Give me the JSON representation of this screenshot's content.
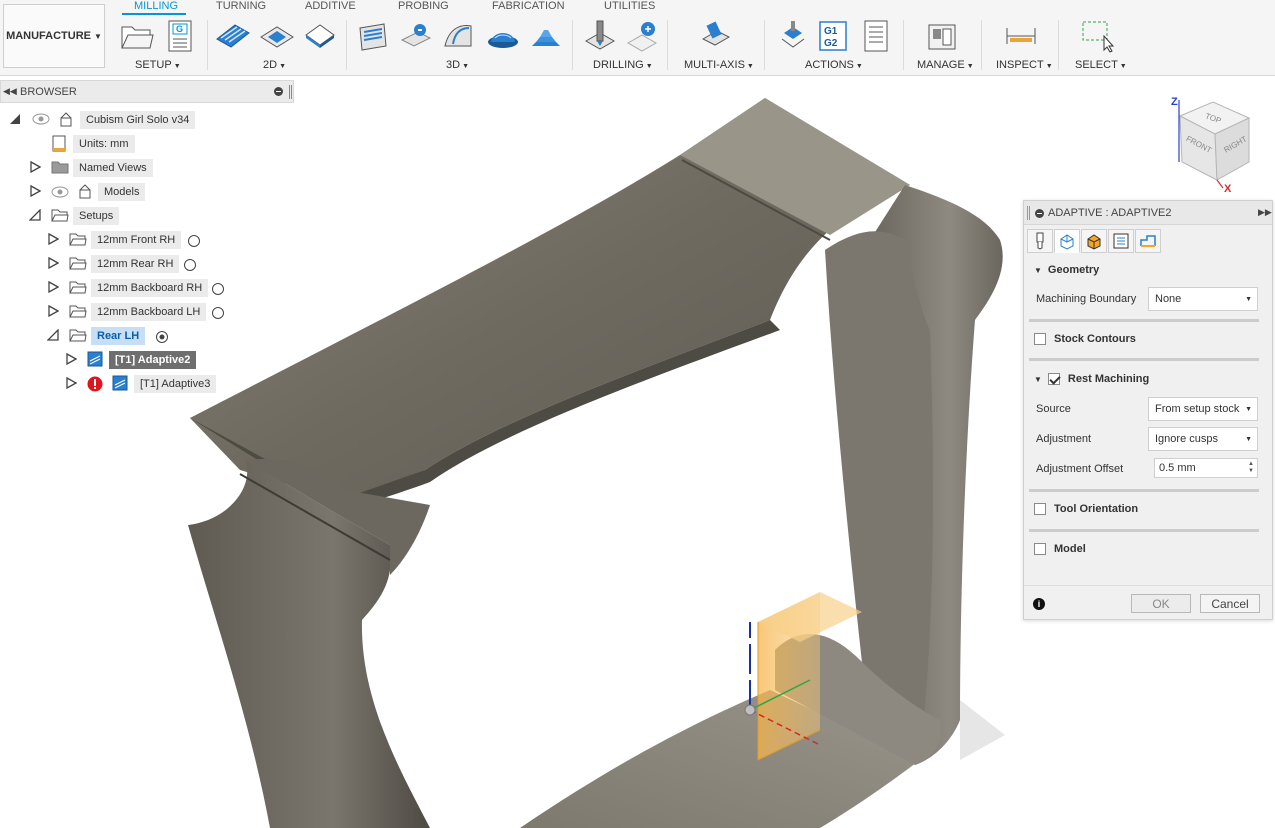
{
  "workspace": {
    "label": "MANUFACTURE"
  },
  "tabs": [
    {
      "label": "MILLING",
      "active": true
    },
    {
      "label": "TURNING"
    },
    {
      "label": "ADDITIVE"
    },
    {
      "label": "PROBING"
    },
    {
      "label": "FABRICATION"
    },
    {
      "label": "UTILITIES"
    }
  ],
  "groups": {
    "setup": "SETUP",
    "g2d": "2D",
    "g3d": "3D",
    "drilling": "DRILLING",
    "multiaxis": "MULTI-AXIS",
    "actions": "ACTIONS",
    "manage": "MANAGE",
    "inspect": "INSPECT",
    "select": "SELECT"
  },
  "icons": {
    "nc_program": "G",
    "post_process": "G1\nG2"
  },
  "browser": {
    "title": "BROWSER",
    "root": "Cubism Girl Solo v34",
    "units": "Units: mm",
    "named_views": "Named Views",
    "models": "Models",
    "setups": "Setups",
    "setup_items": [
      "12mm Front RH",
      "12mm Rear RH",
      "12mm Backboard RH",
      "12mm Backboard LH",
      "Rear LH"
    ],
    "operations": [
      "[T1] Adaptive2",
      "[T1] Adaptive3"
    ]
  },
  "viewcube": {
    "top": "TOP",
    "front": "FRONT",
    "right": "RIGHT",
    "z": "Z",
    "x": "X"
  },
  "panel": {
    "title": "ADAPTIVE : ADAPTIVE2",
    "geometry": "Geometry",
    "machining_boundary_label": "Machining Boundary",
    "machining_boundary_value": "None",
    "stock_contours": "Stock Contours",
    "rest_machining": "Rest Machining",
    "rest_machining_checked": true,
    "source_label": "Source",
    "source_value": "From setup stock",
    "adjustment_label": "Adjustment",
    "adjustment_value": "Ignore cusps",
    "adjustment_offset_label": "Adjustment Offset",
    "adjustment_offset_value": "0.5 mm",
    "tool_orientation": "Tool Orientation",
    "model": "Model",
    "ok": "OK",
    "cancel": "Cancel"
  },
  "colors": {
    "accent": "#0696d7",
    "warning": "#e0141e",
    "stock_box": "#f5a623"
  }
}
